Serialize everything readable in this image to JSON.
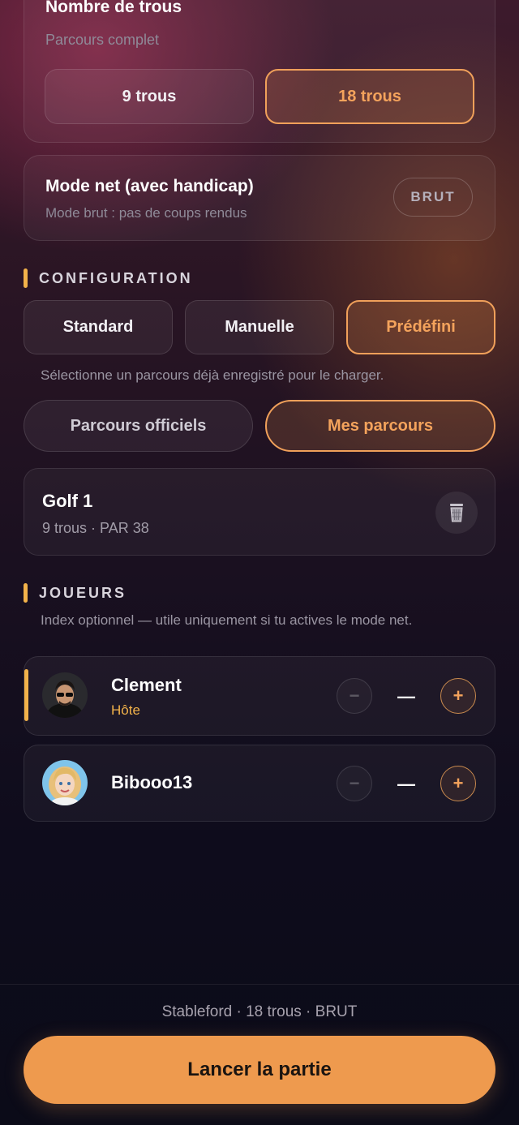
{
  "holes": {
    "title": "Nombre de trous",
    "subtitle": "Parcours complet",
    "options": [
      "9 trous",
      "18 trous"
    ],
    "selected": "18 trous"
  },
  "net_mode": {
    "title": "Mode net (avec handicap)",
    "subtitle": "Mode brut : pas de coups rendus",
    "toggle_label": "BRUT"
  },
  "configuration": {
    "label": "CONFIGURATION",
    "options": [
      "Standard",
      "Manuelle",
      "Prédéfini"
    ],
    "selected": "Prédéfini",
    "hint": "Sélectionne un parcours déjà enregistré pour le charger.",
    "sources": [
      "Parcours officiels",
      "Mes parcours"
    ],
    "selected_source": "Mes parcours"
  },
  "course": {
    "name": "Golf 1",
    "details": "9 trous · PAR 38",
    "delete_icon": "trash-icon"
  },
  "players": {
    "label": "JOUEURS",
    "hint": "Index optionnel — utile uniquement si tu actives le mode net.",
    "list": [
      {
        "name": "Clement",
        "role": "Hôte",
        "index": "—"
      },
      {
        "name": "Bibooo13",
        "role": "",
        "index": "—"
      }
    ],
    "minus_symbol": "−",
    "plus_symbol": "+"
  },
  "footer": {
    "summary": "Stableford · 18 trous · BRUT",
    "launch_label": "Lancer la partie"
  },
  "colors": {
    "accent": "#f0a05a",
    "host_bar": "#f2b24a",
    "launch_button": "#ee9a4e"
  }
}
